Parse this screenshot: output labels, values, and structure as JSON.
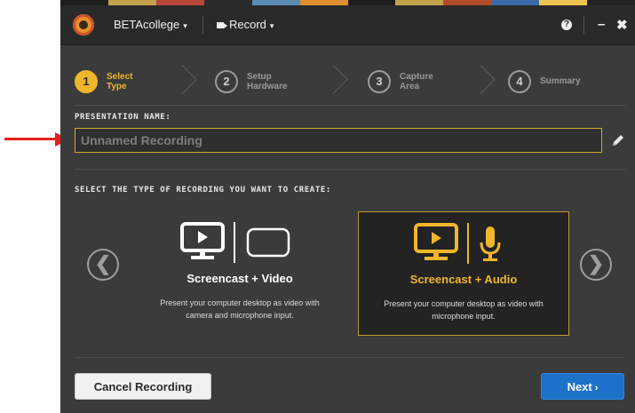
{
  "titlebar": {
    "app_name": "BETAcollege",
    "record_menu": "Record",
    "caret": "▾",
    "help_glyph": "?",
    "minimize_glyph": "–",
    "close_glyph": "✖"
  },
  "steps": [
    {
      "number": "1",
      "line1": "Select",
      "line2": "Type",
      "active": true
    },
    {
      "number": "2",
      "line1": "Setup",
      "line2": "Hardware",
      "active": false
    },
    {
      "number": "3",
      "line1": "Capture",
      "line2": "Area",
      "active": false
    },
    {
      "number": "4",
      "line1": "Summary",
      "line2": "",
      "active": false
    }
  ],
  "presentation": {
    "label": "PRESENTATION NAME:",
    "placeholder": "Unnamed Recording",
    "value": ""
  },
  "recording_types": {
    "label": "SELECT THE TYPE OF RECORDING YOU WANT TO CREATE:",
    "prev_glyph": "❮",
    "next_glyph": "❯",
    "cards": [
      {
        "title": "Screencast + Video",
        "desc1": "Present your computer desktop as video with",
        "desc2": "camera and microphone input.",
        "selected": false
      },
      {
        "title": "Screencast + Audio",
        "desc1": "Present your computer desktop as video with",
        "desc2": "microphone input.",
        "selected": true
      }
    ]
  },
  "footer": {
    "cancel_label": "Cancel Recording",
    "next_label": "Next",
    "next_glyph": "›"
  },
  "icons": {
    "prev": "chevron-left-icon",
    "next": "chevron-right-icon",
    "edit": "pencil-icon",
    "monitor": "monitor-icon",
    "camera": "camera-frame-icon",
    "microphone": "microphone-icon"
  },
  "colors": {
    "accent": "#f0b62b",
    "selected_border": "#c79a30",
    "primary_button": "#1d71c8",
    "annotation_arrow": "#e3211c"
  }
}
